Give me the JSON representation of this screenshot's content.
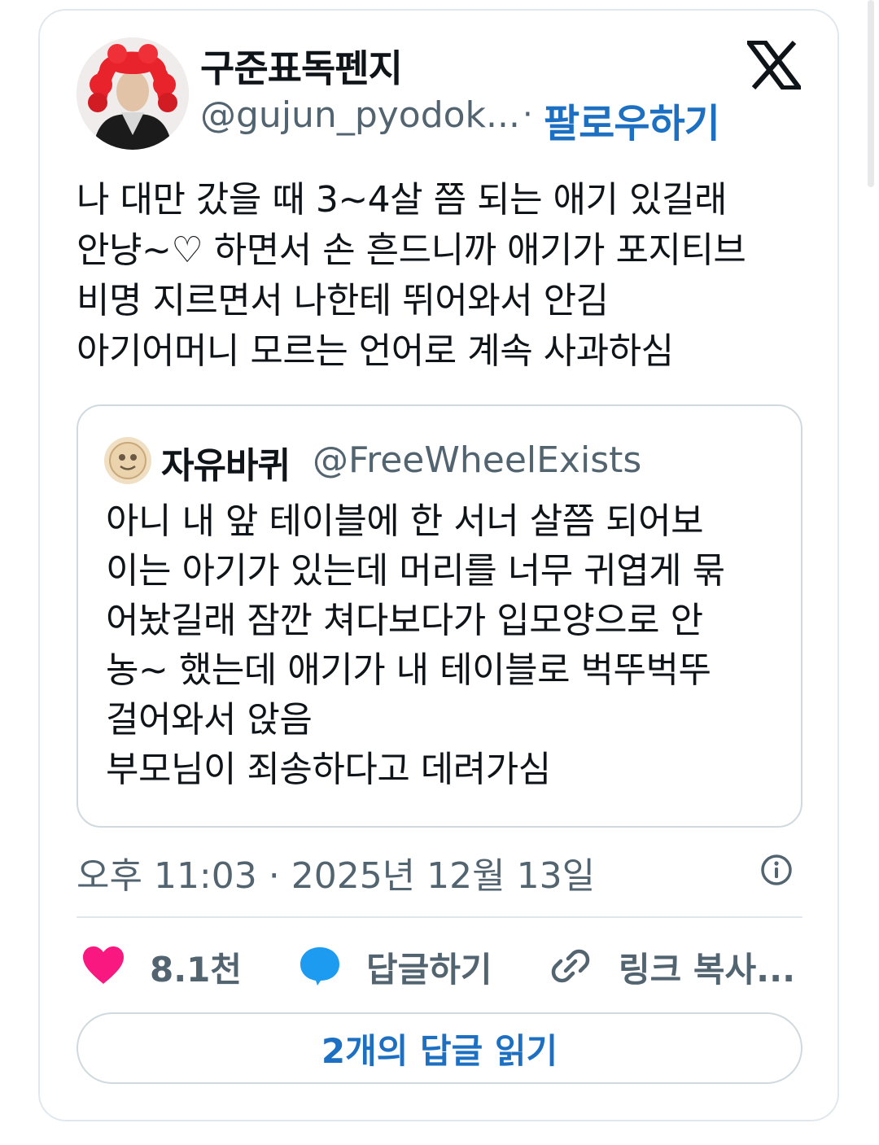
{
  "author": {
    "name": "구준표독펜지",
    "handle": "@gujun_pyodok...",
    "separator": "·",
    "follow_label": "팔로우하기"
  },
  "tweet": {
    "text": "나 대만 갔을 때 3~4살 쯤 되는 애기 있길래\n안냥~♡ 하면서 손 흔드니까 애기가 포지티브\n비명 지르면서 나한테 뛰어와서 안김\n아기어머니 모르는 언어로 계속 사과하심",
    "timestamp": "오후 11:03 · 2025년 12월 13일"
  },
  "quoted": {
    "name": "자유바퀴",
    "handle": "@FreeWheelExists",
    "text": "아니 내 앞 테이블에 한 서너 살쯤 되어보\n이는 아기가 있는데 머리를 너무 귀엽게 묶\n어놨길래 잠깐 쳐다보다가 입모양으로 안\n농~ 했는데 애기가 내 테이블로 벅뚜벅뚜\n걸어와서 앉음\n부모님이 죄송하다고 데려가심"
  },
  "actions": {
    "like_count": "8.1천",
    "reply_label": "답글하기",
    "copy_link_label": "링크 복사..."
  },
  "read_replies_label": "2개의 답글 읽기",
  "colors": {
    "accent": "#1d6fc2",
    "like": "#f91880",
    "reply": "#1d9bf0",
    "secondary_text": "#536471",
    "border": "#cfd9de"
  },
  "icons": [
    "x-logo-icon",
    "info-icon",
    "heart-icon",
    "reply-bubble-icon",
    "link-icon"
  ]
}
